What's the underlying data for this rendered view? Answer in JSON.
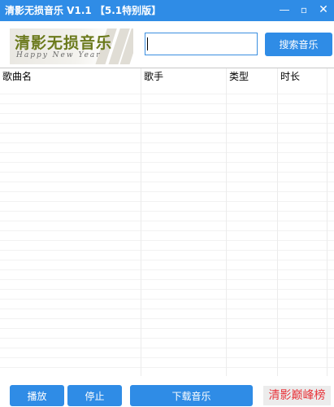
{
  "window": {
    "title": "清影无损音乐 V1.1 【5.1特别版】",
    "minimize_icon": "minimize-icon",
    "maximize_icon": "maximize-icon",
    "close_icon": "close-icon"
  },
  "logo": {
    "title": "清影无损音乐",
    "subtitle": "Happy New Year"
  },
  "search": {
    "value": "",
    "button_label": "搜索音乐"
  },
  "table": {
    "columns": [
      "歌曲名",
      "歌手",
      "类型",
      "时长"
    ],
    "rows": []
  },
  "footer": {
    "play_label": "播放",
    "stop_label": "停止",
    "download_label": "下载音乐",
    "peak_chart_label": "清影巅峰榜"
  },
  "colors": {
    "accent": "#2f8ce6",
    "peak_text": "#e8343a",
    "logo_text": "#6b7a1c"
  }
}
